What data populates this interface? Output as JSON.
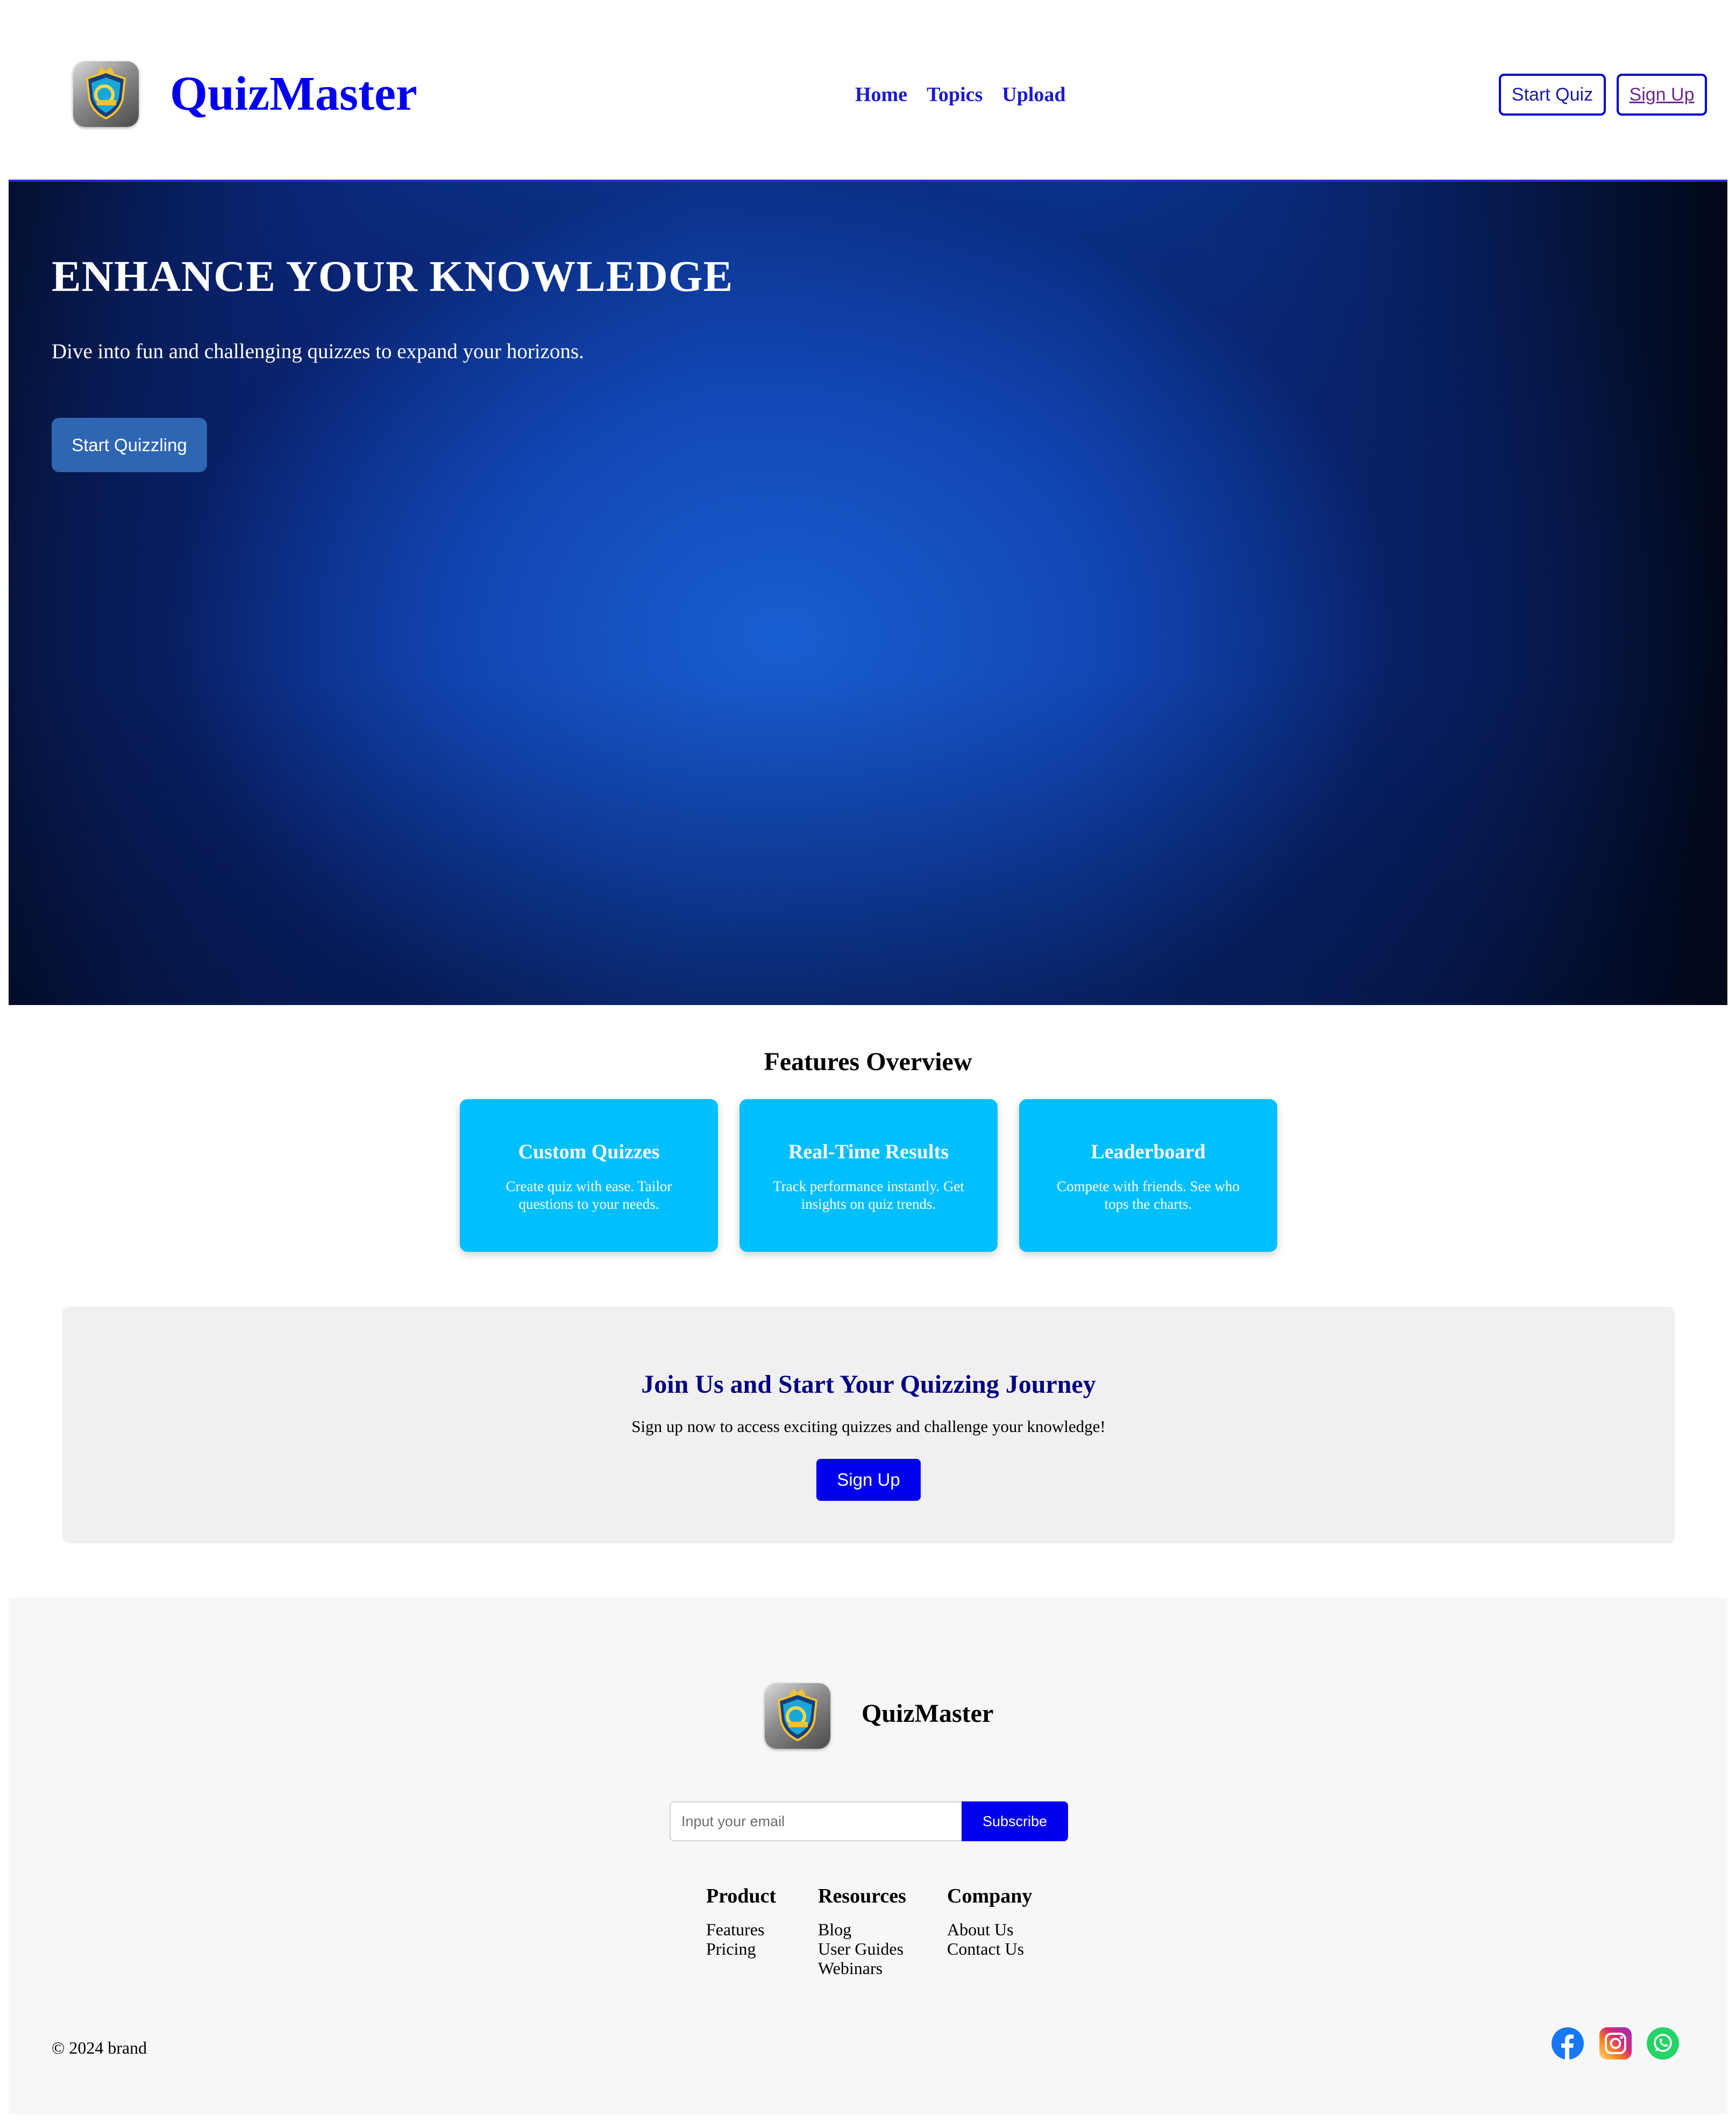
{
  "header": {
    "brand": "QuizMaster",
    "nav": [
      "Home",
      "Topics",
      "Upload"
    ],
    "start_quiz_label": "Start Quiz",
    "sign_up_label": "Sign Up"
  },
  "hero": {
    "title": "ENHANCE YOUR KNOWLEDGE",
    "subtitle": "Dive into fun and challenging quizzes to expand your horizons.",
    "button_label": "Start Quizzling"
  },
  "features": {
    "title": "Features Overview",
    "cards": [
      {
        "title": "Custom Quizzes",
        "text": "Create quiz with ease. Tailor questions to your needs."
      },
      {
        "title": "Real-Time Results",
        "text": "Track performance instantly. Get insights on quiz trends."
      },
      {
        "title": "Leaderboard",
        "text": "Compete with friends. See who tops the charts."
      }
    ]
  },
  "cta": {
    "title": "Join Us and Start Your Quizzing Journey",
    "text": "Sign up now to access exciting quizzes and challenge your knowledge!",
    "button_label": "Sign Up"
  },
  "footer": {
    "brand": "QuizMaster",
    "email_placeholder": "Input your email",
    "subscribe_label": "Subscribe",
    "columns": [
      {
        "title": "Product",
        "links": [
          "Features",
          "Pricing"
        ]
      },
      {
        "title": "Resources",
        "links": [
          "Blog",
          "User Guides",
          "Webinars"
        ]
      },
      {
        "title": "Company",
        "links": [
          "About Us",
          "Contact Us"
        ]
      }
    ],
    "copyright": "© 2024 brand",
    "social_icons": [
      "facebook-icon",
      "instagram-icon",
      "whatsapp-icon"
    ]
  },
  "colors": {
    "brand_blue": "#0000ee",
    "card_cyan": "#00bfff",
    "cta_title": "#000080",
    "hero_button": "#2f66b3"
  }
}
